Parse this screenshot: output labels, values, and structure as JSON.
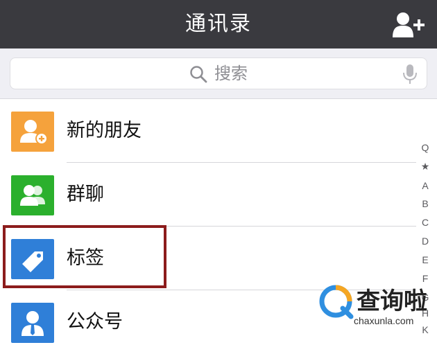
{
  "header": {
    "title": "通讯录",
    "add_contact_icon": "add-user-icon"
  },
  "search": {
    "placeholder": "搜索",
    "search_icon": "magnifier-icon",
    "voice_icon": "microphone-icon"
  },
  "list": {
    "items": [
      {
        "label": "新的朋友",
        "icon": "new-friend-icon",
        "color": "#f5a23c"
      },
      {
        "label": "群聊",
        "icon": "group-chat-icon",
        "color": "#2bb02d"
      },
      {
        "label": "标签",
        "icon": "tag-icon",
        "color": "#2f7fd8"
      },
      {
        "label": "公众号",
        "icon": "official-account-icon",
        "color": "#2f7fd8"
      }
    ]
  },
  "index_bar": {
    "items": [
      "Q",
      "★",
      "A",
      "B",
      "C",
      "D",
      "E",
      "F",
      "G",
      "H",
      "K"
    ]
  },
  "highlight": {
    "color": "#8c1c1c",
    "target": "标签"
  },
  "watermark": {
    "brand": "查询啦",
    "url": "chaxunla.com"
  },
  "colors": {
    "nav_bar": "#3a3a3f",
    "search_bg": "#efeff4"
  }
}
